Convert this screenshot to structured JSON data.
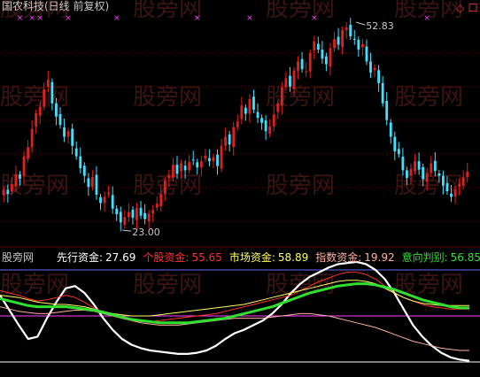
{
  "header": {
    "title": "国农科技(日线 前复权)",
    "top_right_marker": "◇ 口",
    "title_color": "#c8c8c8",
    "marker_color": "#e03030"
  },
  "watermark": {
    "text": "股旁网",
    "color": "#3a1414"
  },
  "colors": {
    "up": "#e02020",
    "down": "#40e0ff",
    "grid": "#5a0000",
    "signal": "#ff40ff",
    "annotation": "#c8c8c8"
  },
  "chart_data": [
    {
      "type": "candlestick",
      "title": "国农科技(日线 前复权)",
      "annotations": [
        {
          "label": "52.83",
          "value": 52.83,
          "at_index": 87
        },
        {
          "label": "23.00",
          "value": 23.0,
          "at_index": 29
        }
      ],
      "ylim": [
        21.5,
        55.0
      ],
      "signal_marks": [
        4,
        7,
        9,
        16,
        28,
        48,
        61,
        77,
        105
      ],
      "closes": [
        28.8,
        28.2,
        29.6,
        31.0,
        30.4,
        33.6,
        34.9,
        37.5,
        39.8,
        40.7,
        43.2,
        44.6,
        41.2,
        39.3,
        38.1,
        36.4,
        37.2,
        35.1,
        33.6,
        31.9,
        30.8,
        29.2,
        30.6,
        28.1,
        26.9,
        27.8,
        28.4,
        26.1,
        25.3,
        24.1,
        24.9,
        25.6,
        24.8,
        26.2,
        25.1,
        24.6,
        25.4,
        25.9,
        26.8,
        28.2,
        30.1,
        30.9,
        32.4,
        31.1,
        32.6,
        31.6,
        32.8,
        33.1,
        32.0,
        32.9,
        33.7,
        32.9,
        33.5,
        32.2,
        35.1,
        36.4,
        35.3,
        37.8,
        38.6,
        40.9,
        39.7,
        41.8,
        40.3,
        39.1,
        38.4,
        37.2,
        37.9,
        39.6,
        41.2,
        43.5,
        44.8,
        43.6,
        45.9,
        47.2,
        46.1,
        45.8,
        48.4,
        50.1,
        48.9,
        47.6,
        46.8,
        49.1,
        50.4,
        49.6,
        51.7,
        52.1,
        50.8,
        50.3,
        48.9,
        49.7,
        47.2,
        45.6,
        46.3,
        44.1,
        41.2,
        38.8,
        36.4,
        34.3,
        33.9,
        31.6,
        30.5,
        31.8,
        32.9,
        31.7,
        30.3,
        31.2,
        32.6,
        31.5,
        30.8,
        29.4,
        28.6,
        27.8,
        28.9,
        29.7,
        30.6,
        31.4
      ]
    },
    {
      "type": "line",
      "legend": [
        {
          "label": "先行资金:",
          "value": "27.69",
          "color": "#ffffff"
        },
        {
          "label": "个股资金:",
          "value": "55.65",
          "color": "#ff3030"
        },
        {
          "label": "市场资金:",
          "value": "58.89",
          "color": "#ffff60"
        },
        {
          "label": "指数资金:",
          "value": "19.92",
          "color": "#ffb0a0"
        },
        {
          "label": "意向判别:",
          "value": "56.85",
          "color": "#30e030"
        }
      ],
      "panel_label": "股旁网",
      "ylim": [
        0,
        100
      ],
      "reference_lines": [
        {
          "value": 90,
          "color": "#6666ff"
        },
        {
          "value": 50,
          "color": "#ff40ff"
        },
        {
          "value": 10,
          "color": "#ffffff"
        }
      ],
      "series": [
        {
          "name": "先行资金",
          "color": "#ffffff",
          "width": 2.2,
          "values": [
            68,
            55,
            42,
            30,
            32,
            48,
            62,
            74,
            76,
            70,
            60,
            48,
            38,
            30,
            25,
            22,
            20,
            19,
            18,
            17,
            17,
            18,
            20,
            24,
            30,
            35,
            38,
            42,
            46,
            52,
            60,
            70,
            78,
            84,
            88,
            92,
            95,
            96,
            97,
            95,
            90,
            82,
            70,
            56,
            42,
            32,
            24,
            18,
            14,
            12,
            11
          ]
        },
        {
          "name": "个股资金",
          "color": "#ff3030",
          "width": 1,
          "values": [
            72,
            70,
            68,
            65,
            63,
            64,
            66,
            68,
            66,
            62,
            57,
            53,
            50,
            48,
            46,
            45,
            45,
            46,
            47,
            48,
            49,
            50,
            51,
            52,
            54,
            56,
            58,
            60,
            62,
            64,
            66,
            68,
            72,
            76,
            80,
            83,
            86,
            88,
            88,
            86,
            82,
            76,
            70,
            66,
            63,
            60,
            58,
            57,
            56,
            56,
            56
          ]
        },
        {
          "name": "市场资金",
          "color": "#ffff60",
          "width": 1,
          "values": [
            68,
            67,
            66,
            64,
            62,
            61,
            60,
            60,
            59,
            58,
            56,
            54,
            52,
            51,
            50,
            50,
            50,
            51,
            52,
            53,
            54,
            55,
            56,
            57,
            58,
            59,
            60,
            62,
            64,
            66,
            68,
            70,
            72,
            74,
            76,
            78,
            80,
            81,
            81,
            80,
            78,
            74,
            70,
            66,
            63,
            61,
            60,
            59,
            59,
            59,
            59
          ]
        },
        {
          "name": "指数资金",
          "color": "#ffb0a0",
          "width": 1,
          "values": [
            58,
            56,
            54,
            53,
            52,
            52,
            53,
            54,
            55,
            55,
            54,
            52,
            50,
            48,
            46,
            44,
            43,
            42,
            42,
            42,
            43,
            44,
            45,
            46,
            47,
            48,
            48,
            48,
            48,
            49,
            50,
            51,
            52,
            52,
            51,
            50,
            48,
            46,
            44,
            42,
            40,
            37,
            34,
            31,
            28,
            26,
            24,
            22,
            21,
            20,
            20
          ]
        },
        {
          "name": "意向判别",
          "color": "#30e030",
          "width": 3,
          "values": [
            65,
            63,
            61,
            59,
            58,
            58,
            58,
            58,
            57,
            56,
            55,
            53,
            51,
            49,
            47,
            46,
            45,
            44,
            44,
            44,
            44,
            45,
            46,
            47,
            48,
            50,
            52,
            54,
            56,
            58,
            61,
            64,
            67,
            70,
            72,
            74,
            76,
            77,
            78,
            78,
            77,
            75,
            73,
            70,
            67,
            64,
            62,
            60,
            58,
            57,
            57
          ]
        }
      ]
    }
  ]
}
